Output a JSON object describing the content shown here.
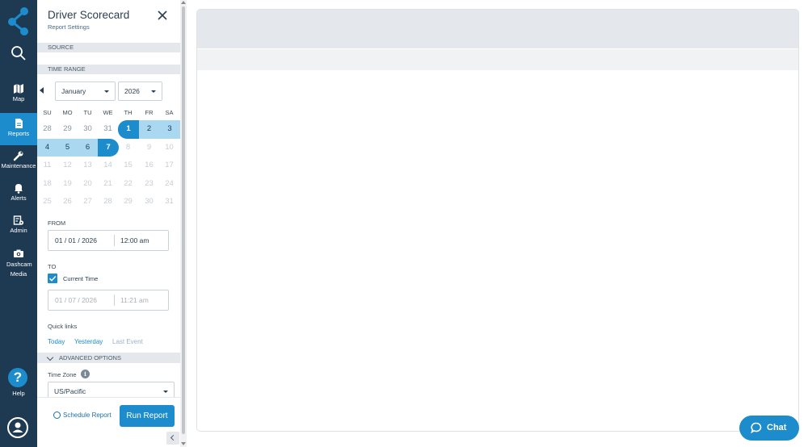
{
  "nav": {
    "items": [
      {
        "label": "Map",
        "icon": "map-icon"
      },
      {
        "label": "Reports",
        "icon": "reports-icon",
        "active": true
      },
      {
        "label": "Maintenance",
        "icon": "wrench-icon"
      },
      {
        "label": "Alerts",
        "icon": "bell-icon"
      },
      {
        "label": "Admin",
        "icon": "admin-icon"
      },
      {
        "label": "Dashcam Media",
        "icon": "camera-icon"
      }
    ],
    "help_label": "Help",
    "help_symbol": "?"
  },
  "panel": {
    "title": "Driver Scorecard",
    "subtitle": "Report Settings",
    "source_label": "SOURCE",
    "time_range_label": "TIME RANGE",
    "month_value": "January",
    "year_value": "2026"
  },
  "calendar": {
    "weekdays": [
      "SU",
      "MO",
      "TU",
      "WE",
      "TH",
      "FR",
      "SA"
    ],
    "weeks": [
      [
        "28",
        "29",
        "30",
        "31",
        "1",
        "2",
        "3"
      ],
      [
        "4",
        "5",
        "6",
        "7",
        "8",
        "9",
        "10"
      ],
      [
        "11",
        "12",
        "13",
        "14",
        "15",
        "16",
        "17"
      ],
      [
        "18",
        "19",
        "20",
        "21",
        "22",
        "23",
        "24"
      ],
      [
        "25",
        "26",
        "27",
        "28",
        "29",
        "30",
        "31"
      ]
    ],
    "range_start": "1",
    "range_end": "7"
  },
  "from": {
    "label": "FROM",
    "date": "01 / 01 / 2026",
    "time": "12:00 am"
  },
  "to": {
    "label": "TO",
    "current_time_label": "Current Time",
    "current_time_checked": true,
    "date": "01 / 07 / 2026",
    "time": "11:21 am"
  },
  "quick_links": {
    "label": "Quick links",
    "today": "Today",
    "yesterday": "Yesterday",
    "last_event": "Last Event"
  },
  "advanced": {
    "label": "ADVANCED OPTIONS",
    "timezone_label": "Time Zone",
    "timezone_value": "US/Pacific"
  },
  "footer": {
    "schedule_label": "Schedule Report",
    "run_label": "Run Report"
  },
  "chat": {
    "label": "Chat"
  },
  "colors": {
    "rail": "#1e3a52",
    "accent": "#1d8ccc",
    "range": "#a9d8f0"
  }
}
